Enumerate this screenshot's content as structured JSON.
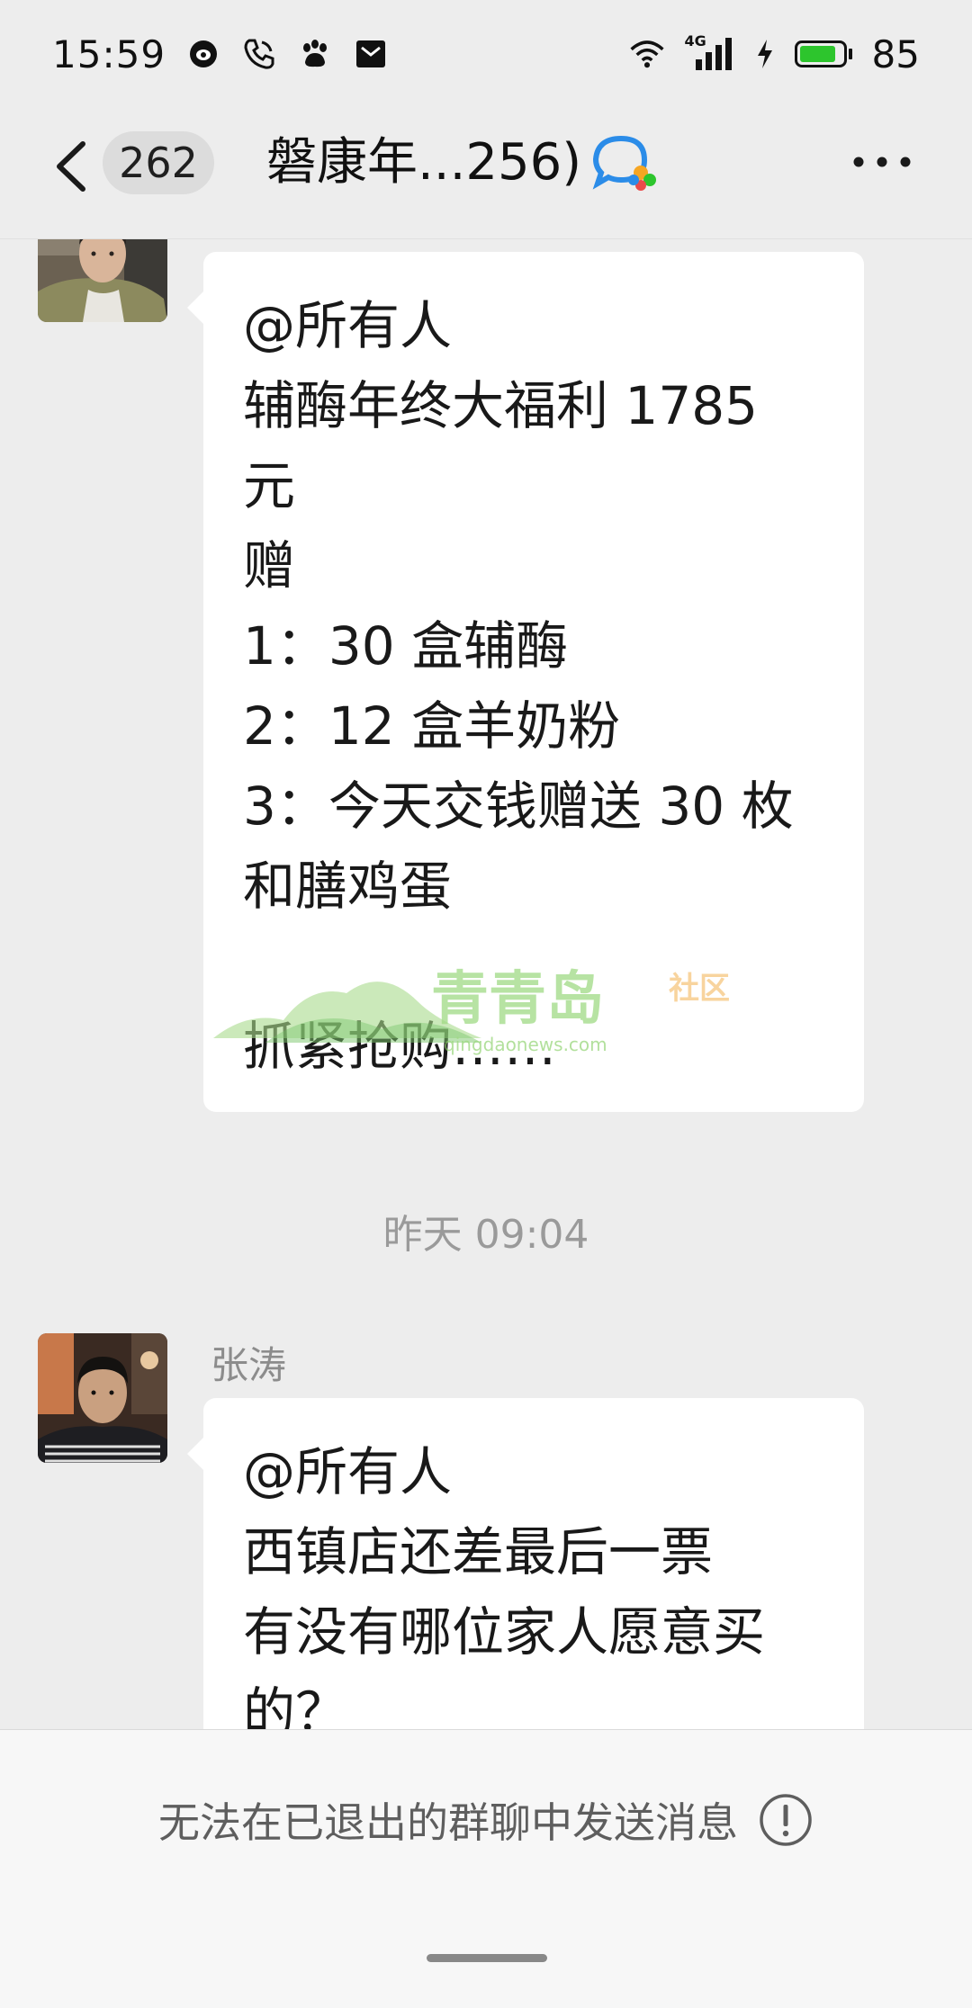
{
  "status_bar": {
    "time": "15:59",
    "network": "4G",
    "battery": "85",
    "battery_level": 0.85,
    "icons": [
      "weibo-icon",
      "phone-icon",
      "paw-icon",
      "mail-icon",
      "wifi-icon",
      "signal-icon",
      "charging-icon",
      "battery-icon"
    ]
  },
  "header": {
    "unread_count": "262",
    "title": "磐康年...256)",
    "icons": [
      "back-chevron-icon",
      "group-chat-icon",
      "more-icon"
    ]
  },
  "messages": [
    {
      "sender": "",
      "lines": [
        "@所有人",
        "辅酶年终大福利 1785",
        "元",
        "赠",
        "1：30 盒辅酶",
        "2：12 盒羊奶粉",
        "3：今天交钱赠送 30 枚",
        "和膳鸡蛋",
        "",
        "抓紧抢购……"
      ]
    },
    {
      "sender": "张涛",
      "lines": [
        "@所有人",
        "西镇店还差最后一票",
        "有没有哪位家人愿意买",
        "的？"
      ]
    }
  ],
  "timestamp": "昨天 09:04",
  "watermark": {
    "brand": "青青岛",
    "suffix": "社区",
    "url": "qingdaonews.com"
  },
  "notice": {
    "text": "无法在已退出的群聊中发送消息"
  },
  "colors": {
    "background": "#EDEDED",
    "bubble": "#FFFFFF",
    "battery_fill": "#2DC52D",
    "watermark_green": "#8FD36F"
  }
}
